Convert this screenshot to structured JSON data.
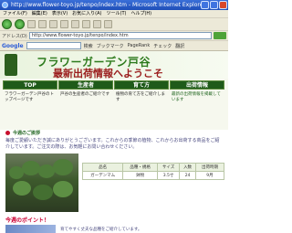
{
  "window": {
    "title": "http://www.flower-toyo.jp/tenpo/index.htm - Microsoft Internet Explorer"
  },
  "menu": [
    "ファイル(F)",
    "編集(E)",
    "表示(V)",
    "お気に入り(A)",
    "ツール(T)",
    "ヘルプ(H)"
  ],
  "address": {
    "label": "アドレス(D)",
    "url": "http://www.flower-toyo.jp/tenpo/index.htm"
  },
  "googlebar": {
    "logo": "Google",
    "items": [
      "検索",
      "ブックマーク",
      "PageRank",
      "チェック",
      "翻訳"
    ]
  },
  "header": {
    "title": "フラワーガーデン戸谷",
    "subtitle": "最新出荷情報へようこそ"
  },
  "nav": [
    {
      "label": "TOP",
      "desc": "フラワーガーデン戸谷のトップページです"
    },
    {
      "label": "生産者",
      "desc": "戸谷の生産者のご紹介です"
    },
    {
      "label": "育て方",
      "desc": "植物の育て方をご紹介します"
    },
    {
      "label": "出荷情報",
      "desc": "最新の出荷情報を掲載しています"
    }
  ],
  "greeting": {
    "heading": "今週のご挨拶",
    "body": "毎度ご愛顧いただき誠にありがとうございます。これからの季節の植物、これからお出荷する商品をご紹介しています。ご注文の際は、お気軽にお問い合わせください。",
    "note": "※出荷状況により変更になる場合がございます"
  },
  "table": {
    "headers": [
      "品名",
      "品種・規格",
      "サイズ",
      "入数",
      "出荷時期"
    ],
    "rows": [
      [
        "ガーデンマム",
        "鉢物",
        "3.5寸",
        "24",
        "9月"
      ]
    ]
  },
  "recommend": {
    "heading": "今週のポイント！",
    "text": "育てやすく丈夫な品種をご紹介しています。"
  }
}
